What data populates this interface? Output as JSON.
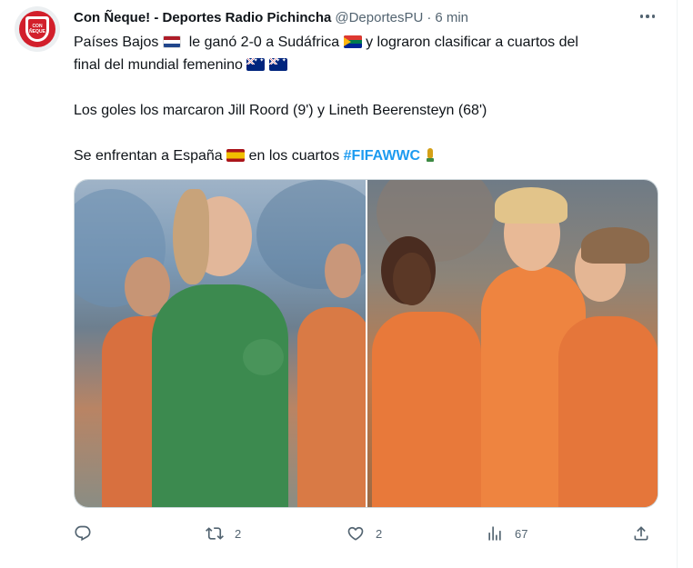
{
  "author": {
    "display_name": "Con Ñeque! - Deportes Radio Pichincha",
    "handle": "@DeportesPU",
    "separator": "·",
    "time": "6 min",
    "avatar_text": "CON ÑEQUE"
  },
  "tweet": {
    "line1_a": "Países Bajos",
    "line1_b": "le ganó 2-0 a Sudáfrica",
    "line1_c": "y  lograron clasificar a cuartos del",
    "line2": "final del mundial femenino",
    "line3": "Los goles los marcaron  Jill Roord (9') y Lineth Beerensteyn (68')",
    "line4": "Se enfrentan a España",
    "line4_b": "en los cuartos",
    "hashtag": "#FIFAWWC"
  },
  "media": {
    "left_description": "goalkeeper-photo",
    "right_description": "team-celebration-photo"
  },
  "actions": {
    "reply_count": "",
    "retweet_count": "2",
    "like_count": "2",
    "views_count": "67"
  },
  "colors": {
    "text": "#0f1419",
    "secondary": "#536471",
    "link": "#1d9bf0",
    "border": "#cfd9de"
  }
}
